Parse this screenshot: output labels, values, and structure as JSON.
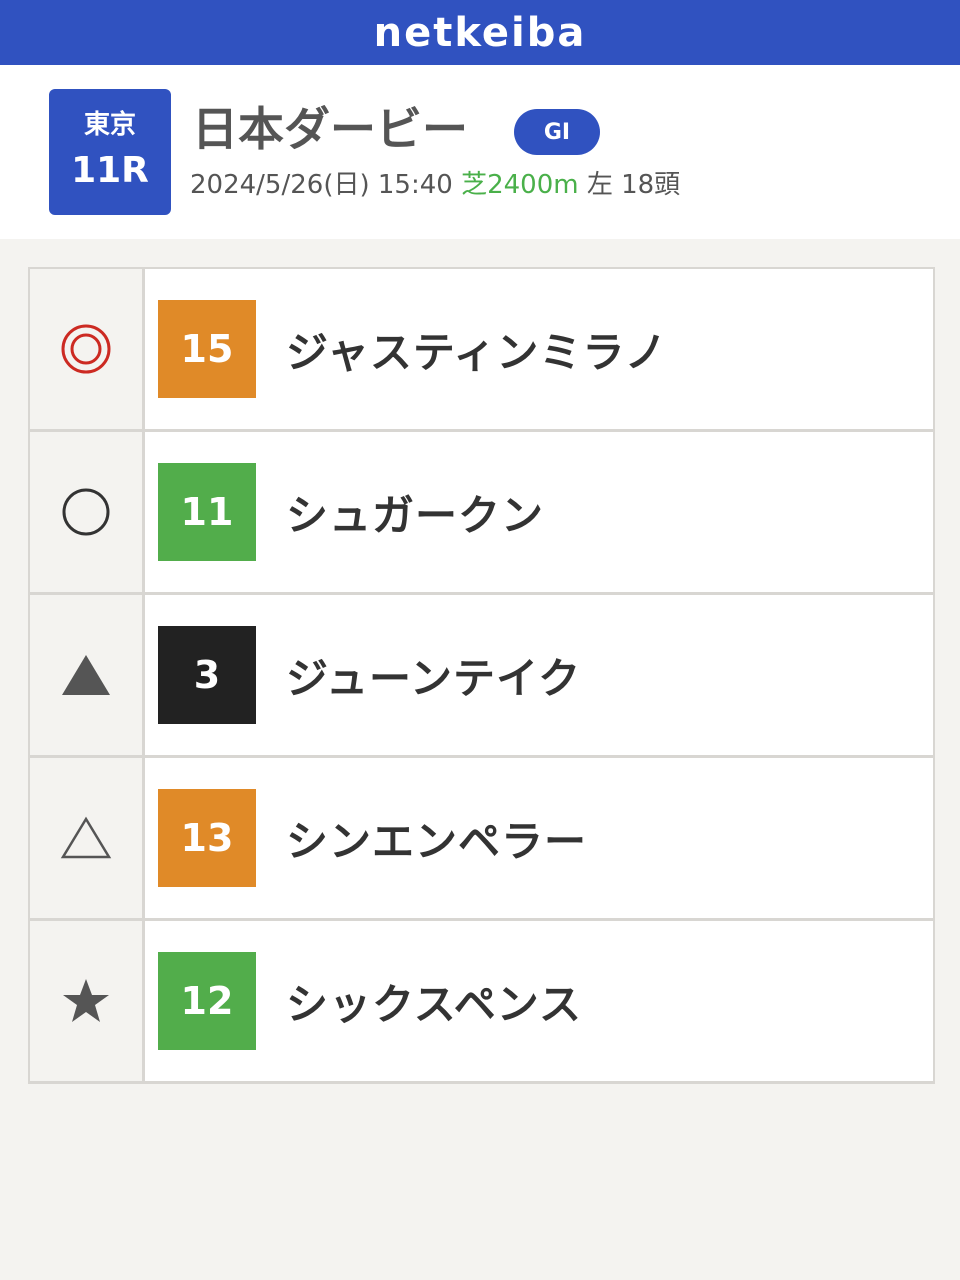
{
  "topbar": {
    "brand": "netkeiba",
    "color": "#3052c0"
  },
  "race": {
    "venue": "東京",
    "race_number": "11R",
    "title": "日本ダービー",
    "grade": "GI",
    "datetime": "2024/5/26(日) 15:40",
    "course": "芝2400m",
    "direction_runners": "左 18頭"
  },
  "picks": [
    {
      "mark": "double-circle",
      "number": "15",
      "name": "ジャスティンミラノ",
      "color": "#e08a28"
    },
    {
      "mark": "circle",
      "number": "11",
      "name": "シュガークン",
      "color": "#52ad4b"
    },
    {
      "mark": "filled-triangle",
      "number": "3",
      "name": "ジューンテイク",
      "color": "#222222"
    },
    {
      "mark": "triangle",
      "number": "13",
      "name": "シンエンペラー",
      "color": "#e08a28"
    },
    {
      "mark": "star",
      "number": "12",
      "name": "シックスペンス",
      "color": "#52ad4b"
    }
  ]
}
